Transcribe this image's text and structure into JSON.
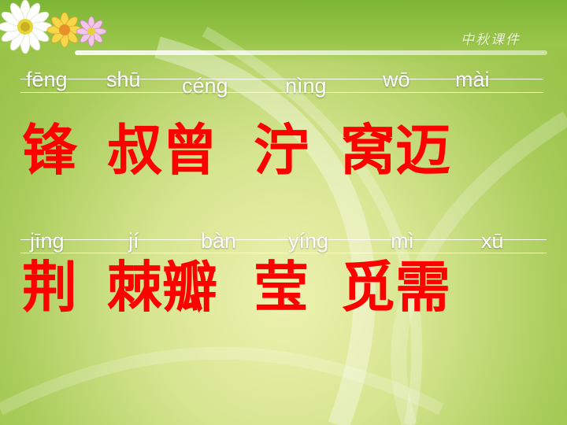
{
  "brand_text": "中秋课件",
  "colors": {
    "hanzi": "#ff0000",
    "pinyin": "#ffffff",
    "background": "#b7d56a"
  },
  "decoration_icons": [
    "daisy-flower-icon",
    "yellow-flower-icon",
    "pink-flower-icon"
  ],
  "row1": {
    "pinyin": [
      "fēng",
      "shū",
      "céng",
      "nìng",
      "wō",
      "mài"
    ],
    "hanzi": [
      "锋",
      "叔曾",
      "泞",
      "窝迈"
    ]
  },
  "row2": {
    "pinyin": [
      "jīng",
      "jí",
      "bàn",
      "yíng",
      "mì",
      "xū"
    ],
    "hanzi": [
      "荆",
      "棘瓣",
      "莹",
      "觅需"
    ]
  }
}
